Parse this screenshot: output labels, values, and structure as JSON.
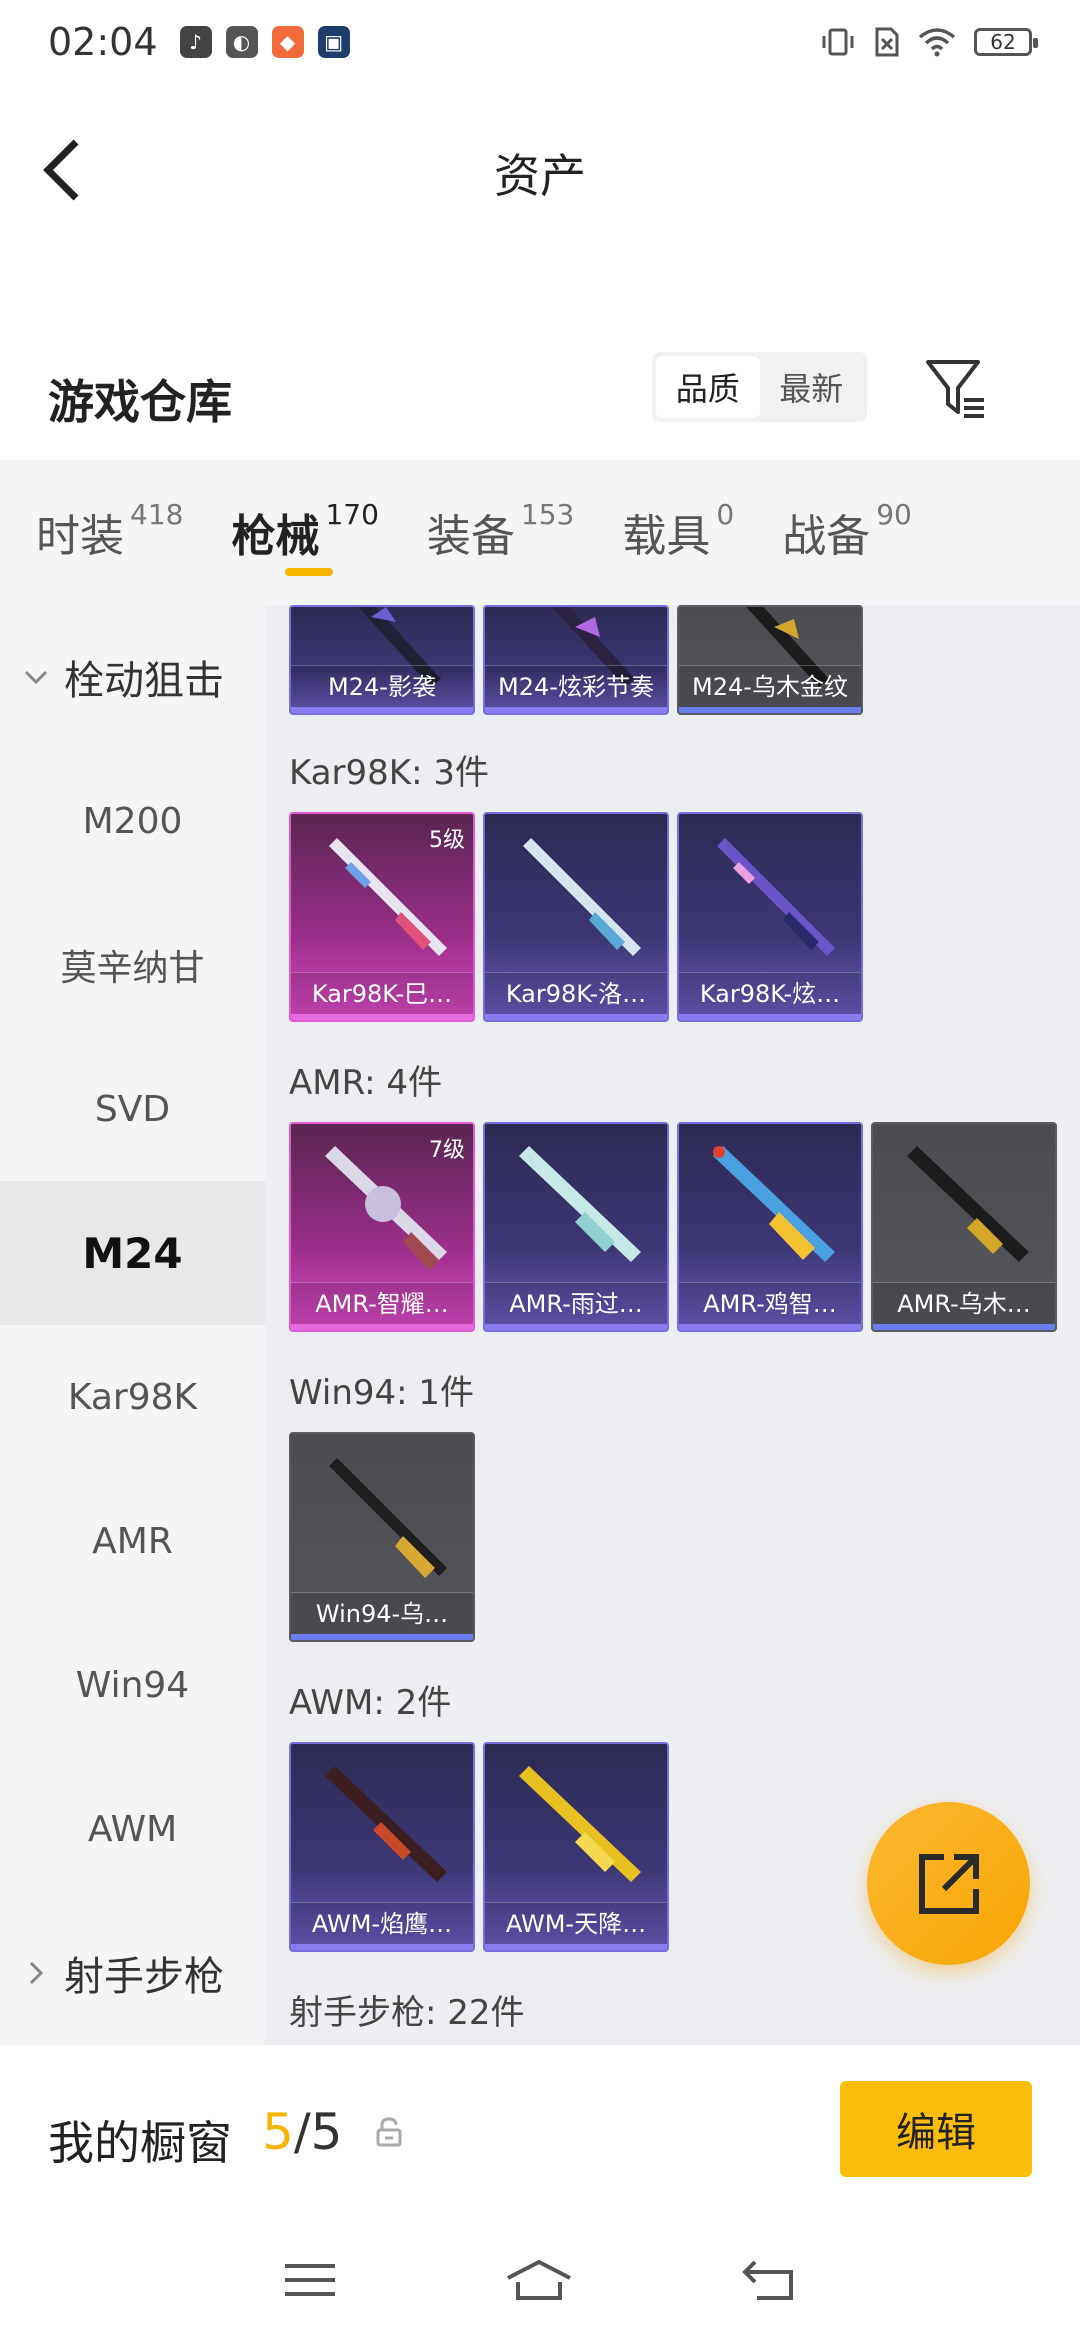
{
  "status": {
    "time": "02:04",
    "battery": "62"
  },
  "header": {
    "title": "资产"
  },
  "section": {
    "title": "游戏仓库",
    "sort_options": [
      "品质",
      "最新"
    ],
    "sort_active": "品质"
  },
  "tabs": [
    {
      "label": "时装",
      "count": "418"
    },
    {
      "label": "枪械",
      "count": "170"
    },
    {
      "label": "装备",
      "count": "153"
    },
    {
      "label": "载具",
      "count": "0"
    },
    {
      "label": "战备",
      "count": "90"
    }
  ],
  "leftnav": {
    "group_top": "栓动狙击",
    "items": [
      "M200",
      "莫辛纳甘",
      "SVD",
      "M24",
      "Kar98K",
      "AMR",
      "Win94",
      "AWM"
    ],
    "active": "M24",
    "group_bottom": "射手步枪"
  },
  "content": {
    "m24_partial": [
      {
        "name": "M24-影袭",
        "rarity": "purple"
      },
      {
        "name": "M24-炫彩节奏",
        "rarity": "purple"
      },
      {
        "name": "M24-乌木金纹",
        "rarity": "gray"
      }
    ],
    "groups": [
      {
        "title": "Kar98K: 3件",
        "items": [
          {
            "name": "Kar98K-巳…",
            "rarity": "pink",
            "level": "5级"
          },
          {
            "name": "Kar98K-洛…",
            "rarity": "purple",
            "level": ""
          },
          {
            "name": "Kar98K-炫…",
            "rarity": "purple",
            "level": ""
          }
        ]
      },
      {
        "title": "AMR: 4件",
        "items": [
          {
            "name": "AMR-智耀…",
            "rarity": "pink",
            "level": "7级"
          },
          {
            "name": "AMR-雨过…",
            "rarity": "purple",
            "level": ""
          },
          {
            "name": "AMR-鸡智…",
            "rarity": "purple",
            "level": ""
          },
          {
            "name": "AMR-乌木…",
            "rarity": "gray",
            "level": ""
          }
        ]
      },
      {
        "title": "Win94: 1件",
        "items": [
          {
            "name": "Win94-乌…",
            "rarity": "gray",
            "level": ""
          }
        ]
      },
      {
        "title": "AWM: 2件",
        "items": [
          {
            "name": "AWM-焰鹰…",
            "rarity": "purple",
            "level": ""
          },
          {
            "name": "AWM-天降…",
            "rarity": "purple",
            "level": ""
          }
        ]
      }
    ],
    "next_group_title": "射手步枪: 22件"
  },
  "shelf": {
    "title": "我的橱窗",
    "current": "5",
    "separator": "/",
    "total": "5",
    "edit_label": "编辑"
  },
  "colors": {
    "accent": "#f7b500",
    "purple": "#7a6de0",
    "pink": "#e05cd5"
  }
}
